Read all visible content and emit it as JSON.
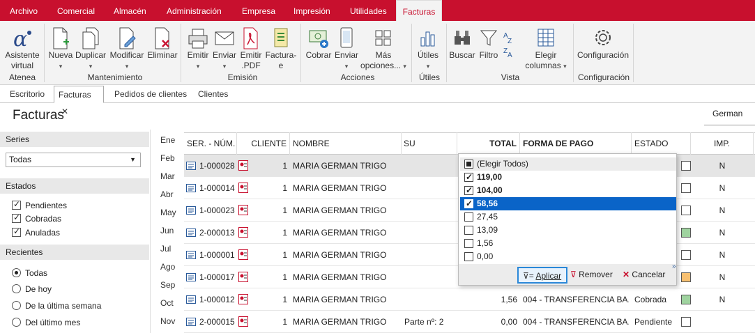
{
  "menu": [
    "Archivo",
    "Comercial",
    "Almacén",
    "Administración",
    "Empresa",
    "Impresión",
    "Utilidades",
    "Facturas"
  ],
  "ribbon": {
    "buttons": {
      "asistente": [
        "Asistente",
        "virtual"
      ],
      "nueva": "Nueva",
      "duplicar": "Duplicar",
      "modificar": "Modificar",
      "eliminar": "Eliminar",
      "emitir": "Emitir",
      "enviar": "Enviar",
      "emitir_pdf": [
        "Emitir",
        ".PDF"
      ],
      "factura_e": [
        "Factura-",
        "e"
      ],
      "cobrar": "Cobrar",
      "enviar2": "Enviar",
      "mas_opciones": [
        "Más",
        "opciones..."
      ],
      "utiles": "Útiles",
      "buscar": "Buscar",
      "filtro": "Filtro",
      "elegir_columnas": [
        "Elegir",
        "columnas"
      ],
      "configuracion": "Configuración"
    },
    "groups": [
      "Atenea",
      "Mantenimiento",
      "Emisión",
      "Acciones",
      "Útiles",
      "Vista",
      "Configuración"
    ]
  },
  "tabs": [
    "Escritorio",
    "Facturas",
    "Pedidos de clientes",
    "Clientes"
  ],
  "page_title": "Facturas",
  "user": "German",
  "filters": {
    "series_label": "Series",
    "series_value": "Todas",
    "estados_label": "Estados",
    "estados": [
      "Pendientes",
      "Cobradas",
      "Anuladas"
    ],
    "recientes_label": "Recientes",
    "recientes": [
      "Todas",
      "De hoy",
      "De la última semana",
      "Del último mes"
    ]
  },
  "months": [
    "Ene",
    "Feb",
    "Mar",
    "Abr",
    "May",
    "Jun",
    "Jul",
    "Ago",
    "Sep",
    "Oct",
    "Nov"
  ],
  "grid": {
    "headers": [
      "SER. - NÚM.",
      "CLIENTE",
      "NOMBRE",
      "SU REFERE...",
      "TOTAL",
      "FORMA DE PAGO",
      "ESTADO",
      "IMP."
    ],
    "rows": [
      {
        "num": "1-000028",
        "cliente": "1",
        "nombre": "MARIA GERMAN TRIGO",
        "ref": "",
        "total": "",
        "forma": "",
        "estado": "",
        "imp": "N"
      },
      {
        "num": "1-000014",
        "cliente": "1",
        "nombre": "MARIA GERMAN TRIGO",
        "ref": "",
        "total": "",
        "forma": "",
        "estado": "",
        "imp": "N"
      },
      {
        "num": "1-000023",
        "cliente": "1",
        "nombre": "MARIA GERMAN TRIGO",
        "ref": "",
        "total": "",
        "forma": "",
        "estado": "",
        "imp": "N"
      },
      {
        "num": "2-000013",
        "cliente": "1",
        "nombre": "MARIA GERMAN TRIGO",
        "ref": "",
        "total": "",
        "forma": "",
        "estado": "",
        "imp": "N"
      },
      {
        "num": "1-000001",
        "cliente": "1",
        "nombre": "MARIA GERMAN TRIGO",
        "ref": "",
        "total": "",
        "forma": "",
        "estado": "",
        "imp": "N"
      },
      {
        "num": "1-000017",
        "cliente": "1",
        "nombre": "MARIA GERMAN TRIGO",
        "ref": "",
        "total": "",
        "forma": "",
        "estado": "",
        "imp": "N"
      },
      {
        "num": "1-000012",
        "cliente": "1",
        "nombre": "MARIA GERMAN TRIGO",
        "ref": "",
        "total": "1,56",
        "forma": "004 - TRANSFERENCIA BA...",
        "estado": "Cobrada",
        "imp": "N"
      },
      {
        "num": "2-000015",
        "cliente": "1",
        "nombre": "MARIA GERMAN TRIGO",
        "ref": "Parte nº: 2",
        "total": "0,00",
        "forma": "004 - TRANSFERENCIA BA...",
        "estado": "Pendiente",
        "imp": ""
      }
    ]
  },
  "popup": {
    "items": [
      "(Elegir Todos)",
      "119,00",
      "104,00",
      "58,56",
      "27,45",
      "13,09",
      "1,56",
      "0,00"
    ],
    "apply": "Aplicar",
    "remove": "Remover",
    "cancel": "Cancelar"
  },
  "colors": {
    "brand": "#c8102e",
    "highlight": "#0a64c8"
  }
}
